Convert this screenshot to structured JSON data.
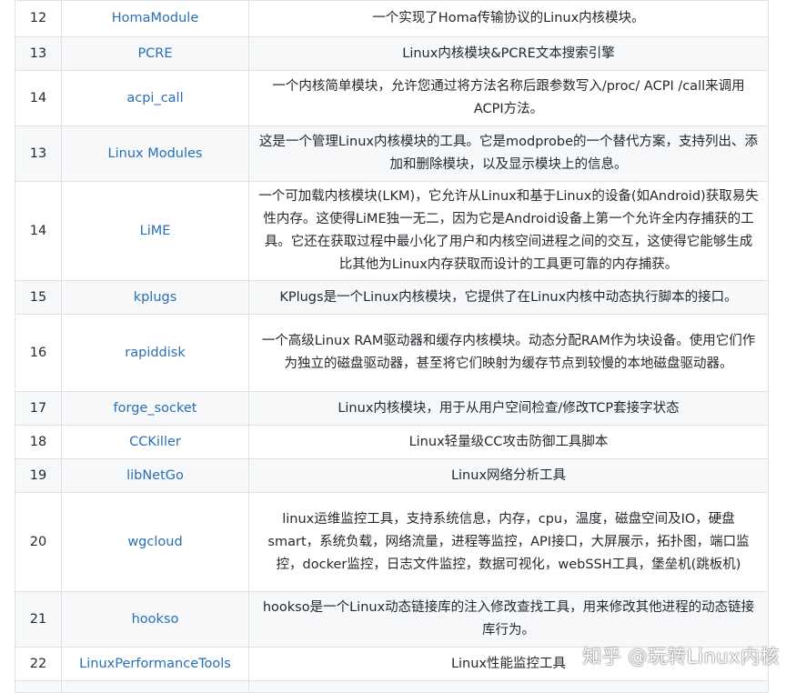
{
  "rows": [
    {
      "num": "12",
      "name": "HomaModule",
      "desc": "一个实现了Homa传输协议的Linux内核模块。"
    },
    {
      "num": "13",
      "name": "PCRE",
      "desc": "Linux内核模块&PCRE文本搜索引擎"
    },
    {
      "num": "14",
      "name": "acpi_call",
      "desc": "一个内核简单模块，允许您通过将方法名称后跟参数写入/proc/ ACPI /call来调用ACPI方法。"
    },
    {
      "num": "13",
      "name": "Linux Modules",
      "desc": "这是一个管理Linux内核模块的工具。它是modprobe的一个替代方案，支持列出、添加和删除模块，以及显示模块上的信息。"
    },
    {
      "num": "14",
      "name": "LiME",
      "desc": "一个可加载内核模块(LKM)，它允许从Linux和基于Linux的设备(如Android)获取易失性内存。这使得LiME独一无二，因为它是Android设备上第一个允许全内存捕获的工具。它还在获取过程中最小化了用户和内核空间进程之间的交互，这使得它能够生成比其他为Linux内存获取而设计的工具更可靠的内存捕获。"
    },
    {
      "num": "15",
      "name": "kplugs",
      "desc": "KPlugs是一个Linux内核模块，它提供了在Linux内核中动态执行脚本的接口。"
    },
    {
      "num": "16",
      "name": "rapiddisk",
      "desc": "一个高级Linux RAM驱动器和缓存内核模块。动态分配RAM作为块设备。使用它们作为独立的磁盘驱动器，甚至将它们映射为缓存节点到较慢的本地磁盘驱动器。"
    },
    {
      "num": "17",
      "name": "forge_socket",
      "desc": "Linux内核模块，用于从用户空间检查/修改TCP套接字状态"
    },
    {
      "num": "18",
      "name": "CCKiller",
      "desc": "Linux轻量级CC攻击防御工具脚本"
    },
    {
      "num": "19",
      "name": "libNetGo",
      "desc": "Linux网络分析工具"
    },
    {
      "num": "20",
      "name": "wgcloud",
      "desc": "linux运维监控工具，支持系统信息，内存，cpu，温度，磁盘空间及IO，硬盘smart，系统负载，网络流量，进程等监控，API接口，大屏展示，拓扑图，端口监控，docker监控，日志文件监控，数据可视化，webSSH工具，堡垒机(跳板机)"
    },
    {
      "num": "21",
      "name": "hookso",
      "desc": "hookso是一个Linux动态链接库的注入修改查找工具，用来修改其他进程的动态链接库行为。"
    },
    {
      "num": "22",
      "name": "LinuxPerformanceTools",
      "desc": "Linux性能监控工具"
    }
  ],
  "watermark": "知乎 @玩转Linux内核",
  "colors": {
    "link": "#2a6fb4",
    "border": "#dfe2e5",
    "stripe": "#f6f8fa",
    "text": "#24292e"
  }
}
